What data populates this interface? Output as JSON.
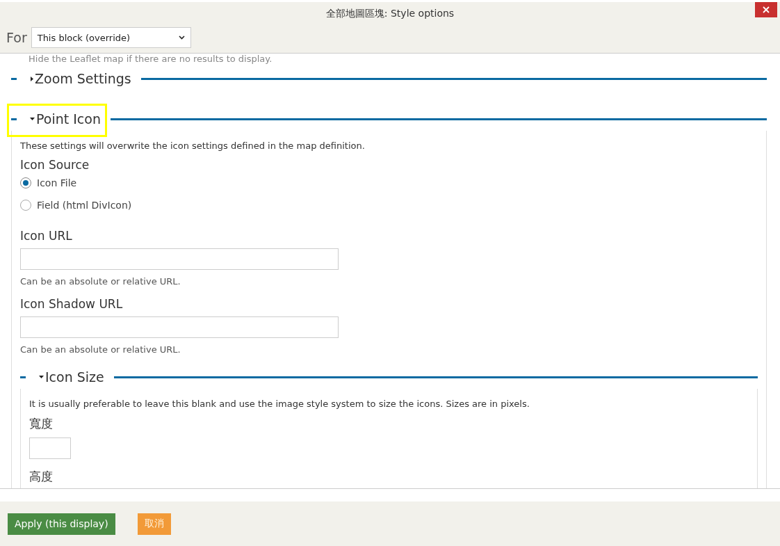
{
  "dialog": {
    "title": "全部地圖區塊: Style options"
  },
  "for_select": {
    "label": "For",
    "value": "This block (override)"
  },
  "intro_text": "Hide the Leaflet map if there are no results to display.",
  "fieldsets": [
    {
      "legend": "Zoom Settings",
      "expanded": false,
      "highlighted": false
    },
    {
      "legend": "Point Icon",
      "expanded": true,
      "highlighted": true,
      "description": "These settings will overwrite the icon settings defined in the map definition.",
      "items": [
        {
          "kind": "radios",
          "label": "Icon Source",
          "options": [
            {
              "label": "Icon File",
              "selected": true
            },
            {
              "label": "Field (html DivIcon)",
              "selected": false
            }
          ]
        },
        {
          "kind": "text",
          "label": "Icon URL",
          "help": "Can be an absolute or relative URL."
        },
        {
          "kind": "text",
          "label": "Icon Shadow URL",
          "help": "Can be an absolute or relative URL."
        },
        {
          "kind": "fieldset",
          "legend": "Icon Size",
          "expanded": true,
          "description": "It is usually preferable to leave this blank and use the image style system to size the icons. Sizes are in pixels.",
          "items": [
            {
              "kind": "small_text",
              "label": "寬度"
            },
            {
              "kind": "label",
              "label": "高度"
            }
          ]
        }
      ]
    }
  ],
  "buttons": [
    {
      "label": "Apply (this display)",
      "kind": "primary"
    },
    {
      "label": "取消",
      "kind": "cancel"
    }
  ]
}
